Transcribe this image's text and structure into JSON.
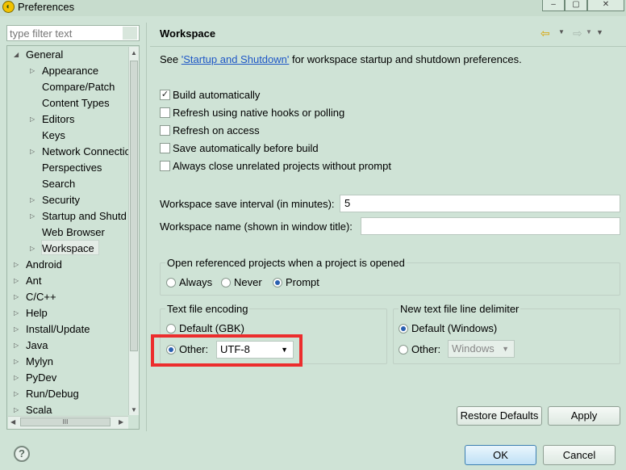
{
  "window": {
    "title": "Preferences",
    "icon": "eclipse-app-icon",
    "controls": [
      "minimize",
      "maximize",
      "close"
    ]
  },
  "filter": {
    "placeholder": "type filter text",
    "value": ""
  },
  "tree": {
    "selected": "Workspace",
    "items": [
      {
        "label": "General",
        "level": 0,
        "state": "expanded"
      },
      {
        "label": "Appearance",
        "level": 1,
        "state": "collapsed"
      },
      {
        "label": "Compare/Patch",
        "level": 1,
        "state": "leaf"
      },
      {
        "label": "Content Types",
        "level": 1,
        "state": "leaf"
      },
      {
        "label": "Editors",
        "level": 1,
        "state": "collapsed"
      },
      {
        "label": "Keys",
        "level": 1,
        "state": "leaf"
      },
      {
        "label": "Network Connectio",
        "level": 1,
        "state": "collapsed"
      },
      {
        "label": "Perspectives",
        "level": 1,
        "state": "leaf"
      },
      {
        "label": "Search",
        "level": 1,
        "state": "leaf"
      },
      {
        "label": "Security",
        "level": 1,
        "state": "collapsed"
      },
      {
        "label": "Startup and Shutd",
        "level": 1,
        "state": "collapsed"
      },
      {
        "label": "Web Browser",
        "level": 1,
        "state": "leaf"
      },
      {
        "label": "Workspace",
        "level": 1,
        "state": "collapsed"
      },
      {
        "label": "Android",
        "level": 0,
        "state": "collapsed"
      },
      {
        "label": "Ant",
        "level": 0,
        "state": "collapsed"
      },
      {
        "label": "C/C++",
        "level": 0,
        "state": "collapsed"
      },
      {
        "label": "Help",
        "level": 0,
        "state": "collapsed"
      },
      {
        "label": "Install/Update",
        "level": 0,
        "state": "collapsed"
      },
      {
        "label": "Java",
        "level": 0,
        "state": "collapsed"
      },
      {
        "label": "Mylyn",
        "level": 0,
        "state": "collapsed"
      },
      {
        "label": "PyDev",
        "level": 0,
        "state": "collapsed"
      },
      {
        "label": "Run/Debug",
        "level": 0,
        "state": "collapsed"
      },
      {
        "label": "Scala",
        "level": 0,
        "state": "collapsed"
      }
    ],
    "hscroll_thumb_label": "III"
  },
  "page": {
    "title": "Workspace",
    "intro_prefix": "See ",
    "intro_link": "'Startup and Shutdown'",
    "intro_suffix": " for workspace startup and shutdown preferences."
  },
  "checkboxes": [
    {
      "label": "Build automatically",
      "checked": true
    },
    {
      "label": "Refresh using native hooks or polling",
      "checked": false
    },
    {
      "label": "Refresh on access",
      "checked": false
    },
    {
      "label": "Save automatically before build",
      "checked": false
    },
    {
      "label": "Always close unrelated projects without prompt",
      "checked": false
    }
  ],
  "save_interval": {
    "label": "Workspace save interval (in minutes):",
    "value": "5"
  },
  "workspace_name": {
    "label": "Workspace name (shown in window title):",
    "value": ""
  },
  "open_referenced": {
    "legend": "Open referenced projects when a project is opened",
    "options": [
      "Always",
      "Never",
      "Prompt"
    ],
    "selected": "Prompt"
  },
  "encoding": {
    "legend": "Text file encoding",
    "default_label": "Default (GBK)",
    "other_label": "Other:",
    "selected": "Other",
    "other_value": "UTF-8",
    "highlight_color": "#ec2d2d"
  },
  "line_delimiter": {
    "legend": "New text file line delimiter",
    "default_label": "Default (Windows)",
    "other_label": "Other:",
    "selected": "Default",
    "other_value": "Windows"
  },
  "buttons": {
    "restore_defaults": "Restore Defaults",
    "apply": "Apply",
    "ok": "OK",
    "cancel": "Cancel"
  },
  "help_glyph": "?"
}
